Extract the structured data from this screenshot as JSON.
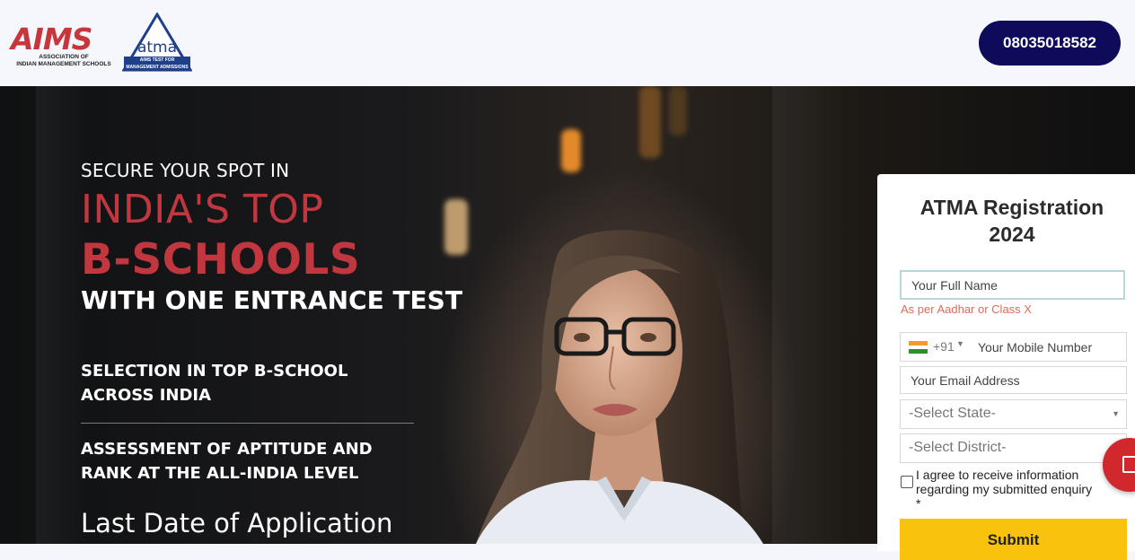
{
  "header": {
    "aims_logo_text": "AIMS",
    "aims_subtitle_line1": "ASSOCIATION OF",
    "aims_subtitle_line2": "INDIAN MANAGEMENT SCHOOLS",
    "atma_logo_text": "atma",
    "atma_caption_line1": "AIMS TEST FOR",
    "atma_caption_line2": "MANAGEMENT ADMISSIONS",
    "phone_number": "08035018582"
  },
  "hero": {
    "tagline_top": "SECURE YOUR SPOT IN",
    "headline_red_1": "INDIA'S TOP",
    "headline_red_2": "B-SCHOOLS",
    "headline_white": "WITH ONE ENTRANCE TEST",
    "features": [
      {
        "line1": "SELECTION IN TOP B-SCHOOL",
        "line2": "ACROSS INDIA"
      },
      {
        "line1": "ASSESSMENT OF APTITUDE AND",
        "line2": "RANK AT THE ALL-INDIA LEVEL"
      }
    ],
    "last_date_text": "Last Date of Application"
  },
  "form": {
    "title_line1": "ATMA Registration",
    "title_line2": "2024",
    "full_name_placeholder": "Your Full Name",
    "full_name_hint": "As per Aadhar or Class X",
    "country_code": "+91",
    "mobile_placeholder": "Your Mobile Number",
    "email_placeholder": "Your Email Address",
    "state_select": "-Select State-",
    "district_select": "-Select District-",
    "consent_line1": "I agree to receive information",
    "consent_line2": "regarding my submitted enquiry",
    "consent_required": "*",
    "submit_label": "Submit"
  },
  "colors": {
    "brand_red": "#c0373f",
    "navy": "#0e0b5a",
    "submit_yellow": "#f9c20d",
    "hint_red": "#e06a5a"
  },
  "icons": {
    "flag": "india-flag-icon",
    "caret": "caret-down-icon",
    "chat": "chat-icon"
  }
}
